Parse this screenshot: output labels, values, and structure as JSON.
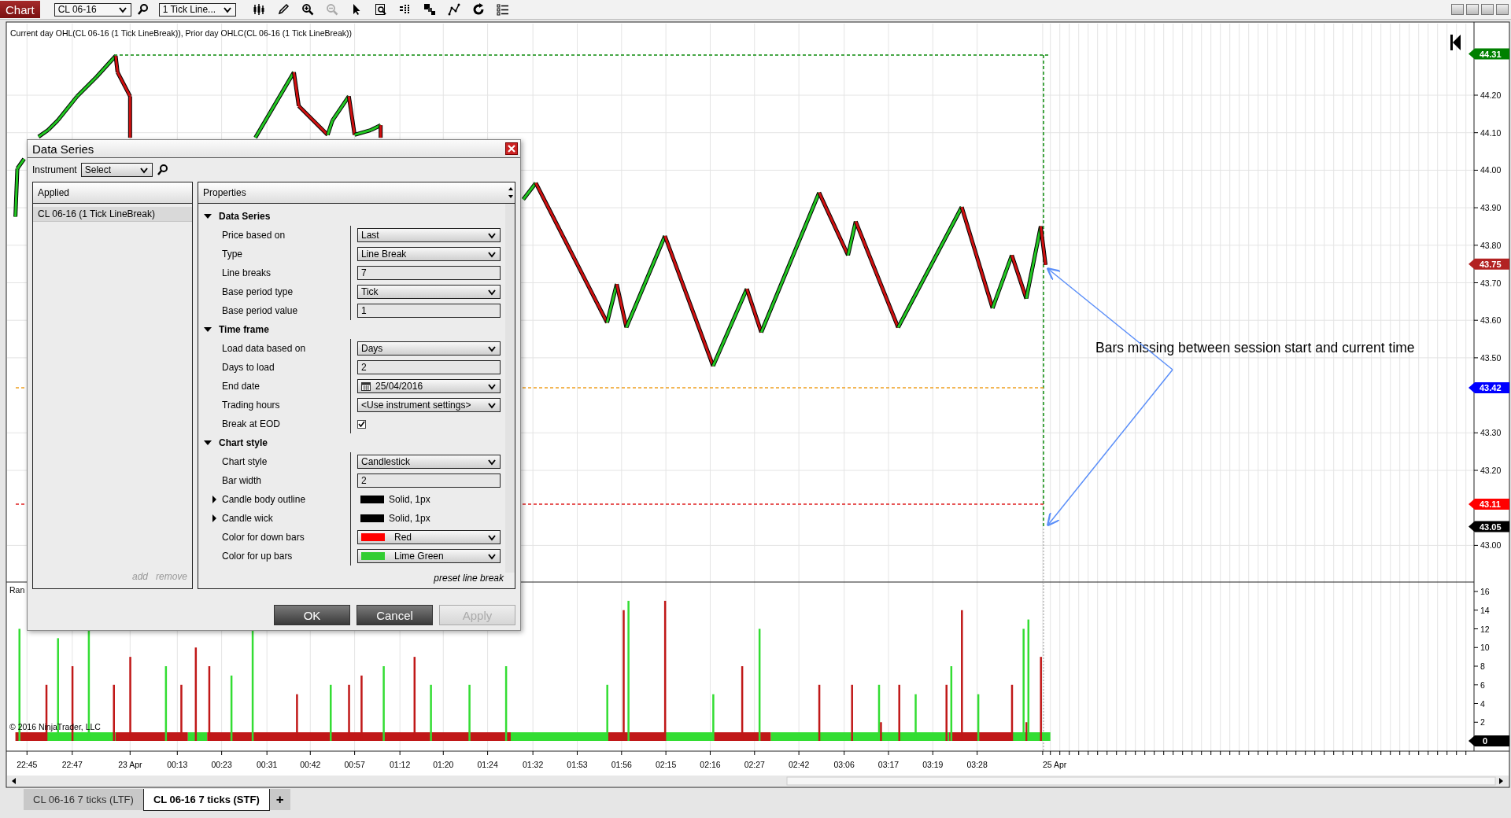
{
  "toolbar": {
    "title": "Chart",
    "instrument": "CL 06-16",
    "interval": "1 Tick Line..."
  },
  "chart": {
    "legend": "Current day OHL(CL 06-16 (1 Tick LineBreak)), Prior day OHLC(CL 06-16 (1 Tick LineBreak))",
    "price_ticks": [
      "44.20",
      "44.10",
      "44.00",
      "43.90",
      "43.80",
      "43.70",
      "43.60",
      "43.50",
      "43.30",
      "43.20",
      "43.00"
    ],
    "price_tags": [
      {
        "label": "44.31",
        "color": "#008000"
      },
      {
        "label": "43.75",
        "color": "#b22222"
      },
      {
        "label": "43.42",
        "color": "#0000ff"
      },
      {
        "label": "43.11",
        "color": "#ff0000"
      },
      {
        "label": "43.05",
        "color": "#000000"
      }
    ],
    "annotation": "Bars missing between session start and current time",
    "indicator_label": "Ran",
    "copyright": "© 2016 NinjaTrader, LLC",
    "volume_ticks": [
      "16",
      "14",
      "12",
      "10",
      "8",
      "6",
      "4",
      "2"
    ],
    "volume_tag": "0",
    "time_labels": [
      "22:45",
      "22:47",
      "23 Apr",
      "00:13",
      "00:23",
      "00:31",
      "00:42",
      "00:57",
      "01:12",
      "01:20",
      "01:24",
      "01:32",
      "01:53",
      "01:56",
      "02:15",
      "02:16",
      "02:27",
      "02:42",
      "03:06",
      "03:17",
      "03:19",
      "03:28",
      "25 Apr"
    ]
  },
  "dialog": {
    "title": "Data Series",
    "instrument_label": "Instrument",
    "instrument_value": "Select",
    "applied_header": "Applied",
    "applied_items": [
      {
        "label": "CL 06-16 (1 Tick LineBreak)",
        "selected": true
      }
    ],
    "add": "add",
    "remove": "remove",
    "properties_header": "Properties",
    "sections": [
      {
        "title": "Data Series",
        "expanded": true,
        "rows": [
          {
            "kind": "dropdown",
            "label": "Price based on",
            "value": "Last"
          },
          {
            "kind": "dropdown",
            "label": "Type",
            "value": "Line Break"
          },
          {
            "kind": "text",
            "label": "Line breaks",
            "value": "7"
          },
          {
            "kind": "dropdown",
            "label": "Base period type",
            "value": "Tick"
          },
          {
            "kind": "text",
            "label": "Base period value",
            "value": "1"
          }
        ]
      },
      {
        "title": "Time frame",
        "expanded": true,
        "rows": [
          {
            "kind": "dropdown",
            "label": "Load data based on",
            "value": "Days"
          },
          {
            "kind": "text",
            "label": "Days to load",
            "value": "2"
          },
          {
            "kind": "date",
            "label": "End date",
            "value": "25/04/2016"
          },
          {
            "kind": "dropdown",
            "label": "Trading hours",
            "value": "<Use instrument settings>"
          },
          {
            "kind": "checkbox",
            "label": "Break at EOD",
            "checked": true
          }
        ]
      },
      {
        "title": "Chart style",
        "expanded": true,
        "rows": [
          {
            "kind": "dropdown",
            "label": "Chart style",
            "value": "Candlestick"
          },
          {
            "kind": "text",
            "label": "Bar width",
            "value": "2"
          },
          {
            "kind": "stroke",
            "label": "Candle body outline",
            "value": "Solid, 1px",
            "color": "#000000",
            "expanded": false
          },
          {
            "kind": "stroke",
            "label": "Candle wick",
            "value": "Solid, 1px",
            "color": "#000000",
            "expanded": false
          },
          {
            "kind": "color",
            "label": "Color for down bars",
            "value": "Red",
            "color": "#ff0000"
          },
          {
            "kind": "color",
            "label": "Color for up bars",
            "value": "Lime Green",
            "color": "#32cd32"
          }
        ]
      }
    ],
    "preset": "preset line break",
    "buttons": [
      {
        "label": "OK",
        "disabled": false
      },
      {
        "label": "Cancel",
        "disabled": false
      },
      {
        "label": "Apply",
        "disabled": true
      }
    ]
  },
  "tabs": [
    {
      "label": "CL 06-16 7 ticks (LTF)",
      "selected": false
    },
    {
      "label": "CL 06-16 7 ticks (STF)",
      "selected": true
    }
  ],
  "add_tab": "+"
}
